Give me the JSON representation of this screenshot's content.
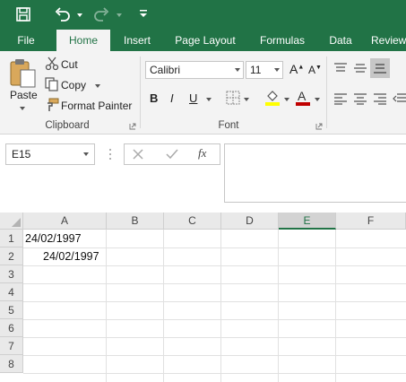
{
  "tabs": [
    "File",
    "Home",
    "Insert",
    "Page Layout",
    "Formulas",
    "Data",
    "Review"
  ],
  "active_tab": "Home",
  "clipboard": {
    "paste_label": "Paste",
    "cut_label": "Cut",
    "copy_label": "Copy",
    "format_painter_label": "Format Painter",
    "group_label": "Clipboard"
  },
  "font": {
    "font_name": "Calibri",
    "font_size": "11",
    "bold": "B",
    "italic": "I",
    "underline": "U",
    "group_label": "Font"
  },
  "formula_bar": {
    "name_box": "E15",
    "fx": "fx",
    "content": ""
  },
  "columns": [
    "A",
    "B",
    "C",
    "D",
    "E",
    "F"
  ],
  "selected_column": "E",
  "rows": [
    "1",
    "2",
    "3",
    "4",
    "5",
    "6",
    "7",
    "8"
  ],
  "cells": {
    "A1": "24/02/1997",
    "A2": "24/02/1997"
  },
  "colors": {
    "brand": "#217346",
    "font_highlight": "#ffff00",
    "font_color": "#c00000"
  }
}
